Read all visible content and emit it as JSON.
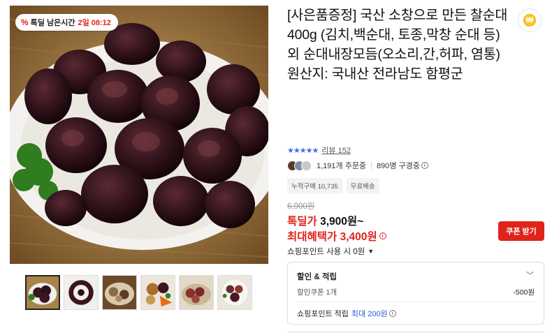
{
  "deal_badge": {
    "icon": "percent-icon",
    "label": "톡딜 남은시간",
    "remaining": "2일 08:12"
  },
  "product": {
    "title": "[사은품증정] 국산 소창으로 만든 찰순대 400g (김치,백순대, 토종,막창 순대 등) 외 순대내장모듬(오소리,간,허파, 염통) 원산지: 국내산 전라남도 함평군"
  },
  "wish_icon": "coin-icon",
  "wish_glyph": "₩",
  "rating": {
    "stars": "★★★★★",
    "review_label": "리뷰 152",
    "star_color": "#4169e1"
  },
  "buyers": {
    "orders": "1,191개 주문중",
    "subscribers": "890명 구경중"
  },
  "tags": [
    "누적구매 10,735",
    "무료배송"
  ],
  "price": {
    "original": "6,900원",
    "deal_label": "톡딜가",
    "deal_value": "3,900원~",
    "max_benefit": "최대혜택가 3,400원",
    "accent_color": "#e0241b"
  },
  "coupon_button": "쿠폰 받기",
  "points_use": "쇼핑포인트 사용 시 0원",
  "benefit": {
    "header": "할인 & 적립",
    "coupon_label": "할인쿠폰 1개",
    "coupon_amount": "-500원",
    "points_label": "쇼핑포인트 적립",
    "points_value": "최대 200원"
  },
  "thumbnails": [
    "thumb-1",
    "thumb-2",
    "thumb-3",
    "thumb-4",
    "thumb-5",
    "thumb-6"
  ]
}
